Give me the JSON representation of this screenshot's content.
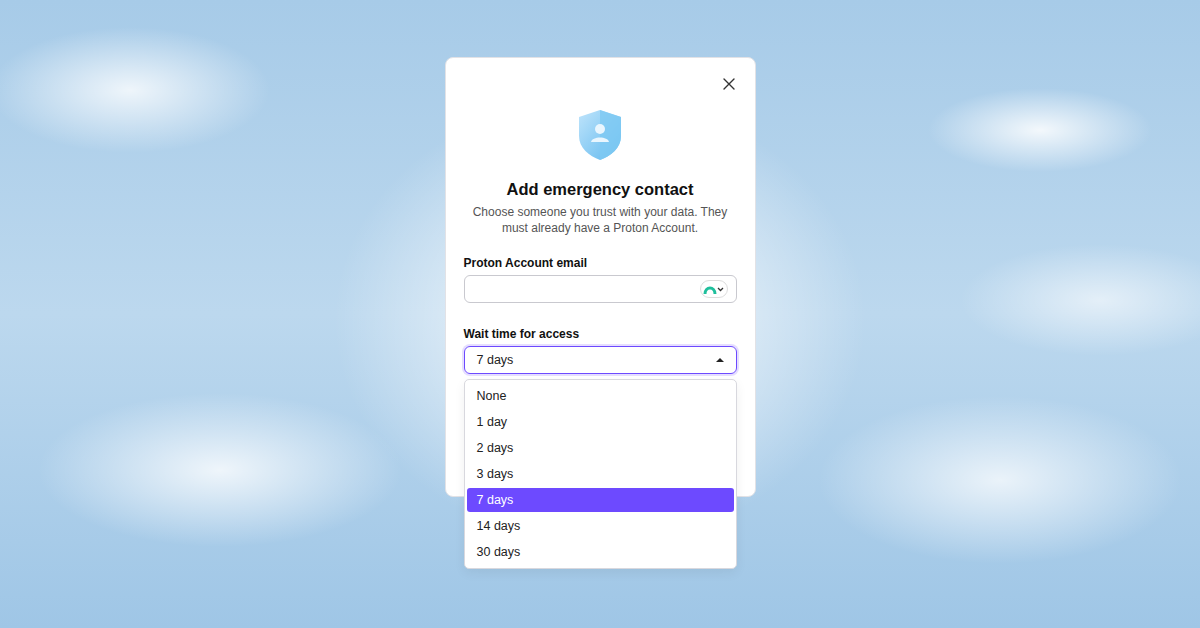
{
  "dialog": {
    "title": "Add emergency contact",
    "description": "Choose someone you trust with your data. They must already have a Proton Account."
  },
  "email_field": {
    "label": "Proton Account email"
  },
  "wait_field": {
    "label": "Wait time for access",
    "value": "7 days",
    "expanded": true
  },
  "options": [
    {
      "label": "None",
      "selected": false
    },
    {
      "label": "1 day",
      "selected": false
    },
    {
      "label": "2 days",
      "selected": false
    },
    {
      "label": "3 days",
      "selected": false
    },
    {
      "label": "7 days",
      "selected": true
    },
    {
      "label": "14 days",
      "selected": false
    },
    {
      "label": "30 days",
      "selected": false
    }
  ]
}
